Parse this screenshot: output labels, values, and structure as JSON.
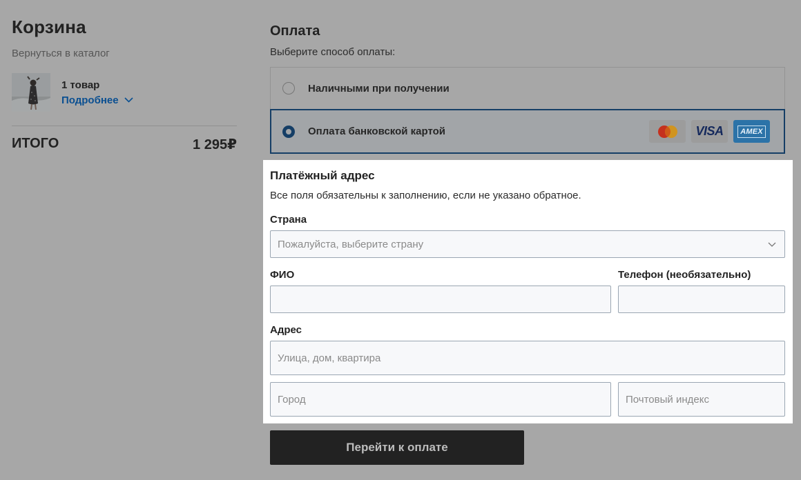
{
  "cart": {
    "title": "Корзина",
    "back_link": "Вернуться в каталог",
    "item_count": "1 товар",
    "more_label": "Подробнее",
    "total_label": "ИТОГО",
    "total_value": "1 295₽"
  },
  "payment": {
    "title": "Оплата",
    "subtitle": "Выберите способ оплаты:",
    "options": [
      {
        "label": "Наличными при получении",
        "selected": false
      },
      {
        "label": "Оплата банковской картой",
        "selected": true
      }
    ],
    "card_logos": [
      "mastercard-icon",
      "visa-icon",
      "amex-icon"
    ],
    "visa_text": "VISA",
    "amex_text": "AMEX"
  },
  "billing": {
    "title": "Платёжный адрес",
    "note": "Все поля обязательны к заполнению, если не указано обратное.",
    "country_label": "Страна",
    "country_placeholder": "Пожалуйста, выберите страну",
    "name_label": "ФИО",
    "phone_label": "Телефон (необязательно)",
    "address_label": "Адрес",
    "street_placeholder": "Улица, дом, квартира",
    "city_placeholder": "Город",
    "zip_placeholder": "Почтовый индекс"
  },
  "submit_label": "Перейти к оплате",
  "colors": {
    "overlay_bg": "#a7a7a7",
    "link": "#0a4f91",
    "selected_border": "#153e66",
    "button_bg": "#222222"
  }
}
